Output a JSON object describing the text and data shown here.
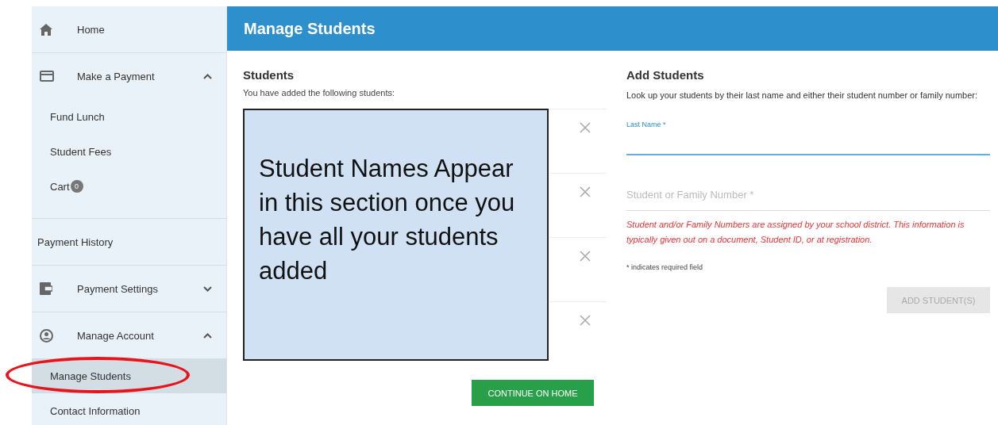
{
  "sidebar": {
    "items": [
      {
        "kind": "section",
        "label": "Home"
      },
      {
        "kind": "section",
        "label": "Make a Payment",
        "expanded": true,
        "children": [
          {
            "label": "Fund Lunch",
            "selected": false,
            "circled": false
          },
          {
            "label": "Student Fees",
            "selected": false,
            "circled": false
          },
          {
            "label": "Cart",
            "badge": "0",
            "selected": false,
            "circled": false
          }
        ]
      },
      {
        "kind": "plain",
        "label": "Payment History"
      },
      {
        "kind": "section",
        "label": "Payment Settings",
        "expanded": false
      },
      {
        "kind": "section",
        "label": "Manage Account",
        "expanded": true,
        "children": [
          {
            "label": "Manage Students",
            "selected": true,
            "circled": true
          },
          {
            "label": "Contact Information",
            "selected": false,
            "circled": false
          }
        ]
      }
    ]
  },
  "header": {
    "title": "Manage Students"
  },
  "students": {
    "title": "Students",
    "subtitle": "You have added the following students:",
    "rows": [
      {
        "removable": true
      },
      {
        "removable": true
      },
      {
        "removable": true
      },
      {
        "removable": true
      }
    ],
    "callout": "Student Names Appear in this section once you have all your students added",
    "continue_button": "CONTINUE ON HOME"
  },
  "add_students": {
    "title": "Add Students",
    "intro": "Look up your students by their last name and either their student number or family number:",
    "fields": [
      {
        "label": "Last Name *",
        "focused": true
      },
      {
        "placeholder": "Student or Family Number *",
        "focused": false
      }
    ],
    "hint": "Student and/or Family Numbers are assigned by your school district. This information is typically given out on a document, Student ID, or at registration.",
    "required_note": "* indicates required field",
    "button": {
      "label": "ADD STUDENT(S)",
      "disabled": true
    }
  }
}
